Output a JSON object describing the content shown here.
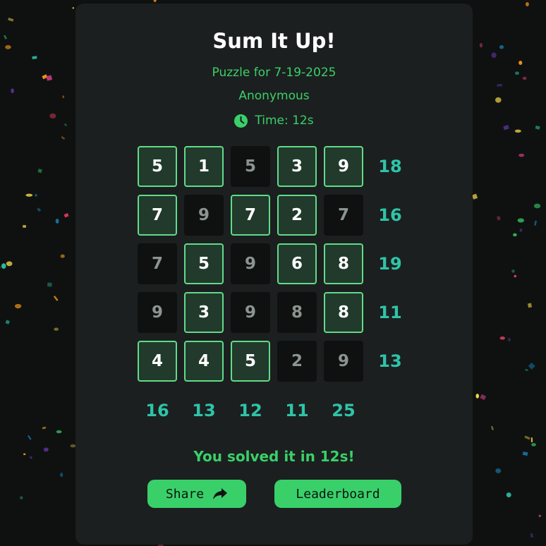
{
  "header": {
    "title": "Sum It Up!",
    "puzzle_date": "Puzzle for 7-19-2025",
    "player": "Anonymous",
    "timer": "Time: 12s"
  },
  "board": {
    "rows": [
      [
        {
          "v": "5",
          "on": true
        },
        {
          "v": "1",
          "on": true
        },
        {
          "v": "5",
          "on": false
        },
        {
          "v": "3",
          "on": true
        },
        {
          "v": "9",
          "on": true
        }
      ],
      [
        {
          "v": "7",
          "on": true
        },
        {
          "v": "9",
          "on": false
        },
        {
          "v": "7",
          "on": true
        },
        {
          "v": "2",
          "on": true
        },
        {
          "v": "7",
          "on": false
        }
      ],
      [
        {
          "v": "7",
          "on": false
        },
        {
          "v": "5",
          "on": true
        },
        {
          "v": "9",
          "on": false
        },
        {
          "v": "6",
          "on": true
        },
        {
          "v": "8",
          "on": true
        }
      ],
      [
        {
          "v": "9",
          "on": false
        },
        {
          "v": "3",
          "on": true
        },
        {
          "v": "9",
          "on": false
        },
        {
          "v": "8",
          "on": false
        },
        {
          "v": "8",
          "on": true
        }
      ],
      [
        {
          "v": "4",
          "on": true
        },
        {
          "v": "4",
          "on": true
        },
        {
          "v": "5",
          "on": true
        },
        {
          "v": "2",
          "on": false
        },
        {
          "v": "9",
          "on": false
        }
      ]
    ],
    "row_targets": [
      "18",
      "16",
      "19",
      "11",
      "13"
    ],
    "col_targets": [
      "16",
      "13",
      "12",
      "11",
      "25"
    ]
  },
  "result": {
    "message": "You solved it in 12s!"
  },
  "actions": {
    "share_label": "Share",
    "leaderboard_label": "Leaderboard"
  },
  "colors": {
    "background": "#0f1111",
    "card": "#1c1f1f",
    "accent": "#39d06a",
    "target": "#2ec4a8",
    "selected_cell": "#213a2c"
  },
  "icons": {
    "timer": "clock-icon",
    "share": "share-arrow-icon"
  }
}
